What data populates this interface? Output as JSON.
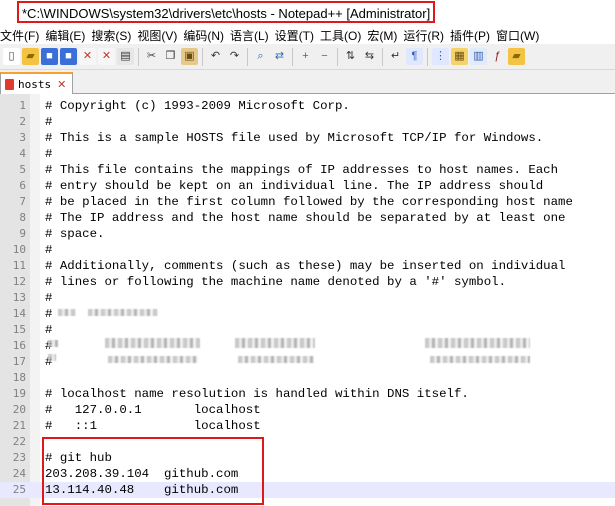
{
  "window": {
    "title": "*C:\\WINDOWS\\system32\\drivers\\etc\\hosts - Notepad++ [Administrator]"
  },
  "menu": {
    "items": [
      "文件(F)",
      "编辑(E)",
      "搜索(S)",
      "视图(V)",
      "编码(N)",
      "语言(L)",
      "设置(T)",
      "工具(O)",
      "宏(M)",
      "运行(R)",
      "插件(P)",
      "窗口(W)"
    ]
  },
  "toolbar": {
    "icons": [
      "new-file-icon",
      "open-file-icon",
      "save-icon",
      "save-all-icon",
      "close-icon",
      "close-all-icon",
      "print-icon",
      "cut-icon",
      "copy-icon",
      "paste-icon",
      "undo-icon",
      "redo-icon",
      "find-icon",
      "replace-icon",
      "zoom-in-icon",
      "zoom-out-icon",
      "sync-vertical-icon",
      "sync-horizontal-icon",
      "word-wrap-icon",
      "show-all-chars-icon",
      "indent-guide-icon",
      "language-icon",
      "doc-map-icon",
      "function-list-icon",
      "folder-workspace-icon"
    ]
  },
  "tabs": [
    {
      "label": "hosts",
      "active": true,
      "modified": true
    }
  ],
  "editor": {
    "current_line": 25,
    "lines": [
      {
        "num": "1",
        "text": "# Copyright (c) 1993-2009 Microsoft Corp."
      },
      {
        "num": "2",
        "text": "#"
      },
      {
        "num": "3",
        "text": "# This is a sample HOSTS file used by Microsoft TCP/IP for Windows."
      },
      {
        "num": "4",
        "text": "#"
      },
      {
        "num": "5",
        "text": "# This file contains the mappings of IP addresses to host names. Each"
      },
      {
        "num": "6",
        "text": "# entry should be kept on an individual line. The IP address should"
      },
      {
        "num": "7",
        "text": "# be placed in the first column followed by the corresponding host name"
      },
      {
        "num": "8",
        "text": "# The IP address and the host name should be separated by at least one"
      },
      {
        "num": "9",
        "text": "# space."
      },
      {
        "num": "10",
        "text": "#"
      },
      {
        "num": "11",
        "text": "# Additionally, comments (such as these) may be inserted on individual"
      },
      {
        "num": "12",
        "text": "# lines or following the machine name denoted by a '#' symbol."
      },
      {
        "num": "13",
        "text": "#"
      },
      {
        "num": "14",
        "text": "#"
      },
      {
        "num": "15",
        "text": "#"
      },
      {
        "num": "16",
        "text": "#"
      },
      {
        "num": "17",
        "text": "#"
      },
      {
        "num": "18",
        "text": ""
      },
      {
        "num": "19",
        "text": "# localhost name resolution is handled within DNS itself."
      },
      {
        "num": "20",
        "text": "#   127.0.0.1       localhost"
      },
      {
        "num": "21",
        "text": "#   ::1             localhost"
      },
      {
        "num": "22",
        "text": ""
      },
      {
        "num": "23",
        "text": "# git hub"
      },
      {
        "num": "24",
        "text": "203.208.39.104  github.com"
      },
      {
        "num": "25",
        "text": "13.114.40.48    github.com"
      }
    ]
  },
  "colors": {
    "annotation": "#e01818",
    "tab_accent": "#f7a130",
    "current_line": "#e8e8ff",
    "gutter": "#e4e4e4"
  }
}
